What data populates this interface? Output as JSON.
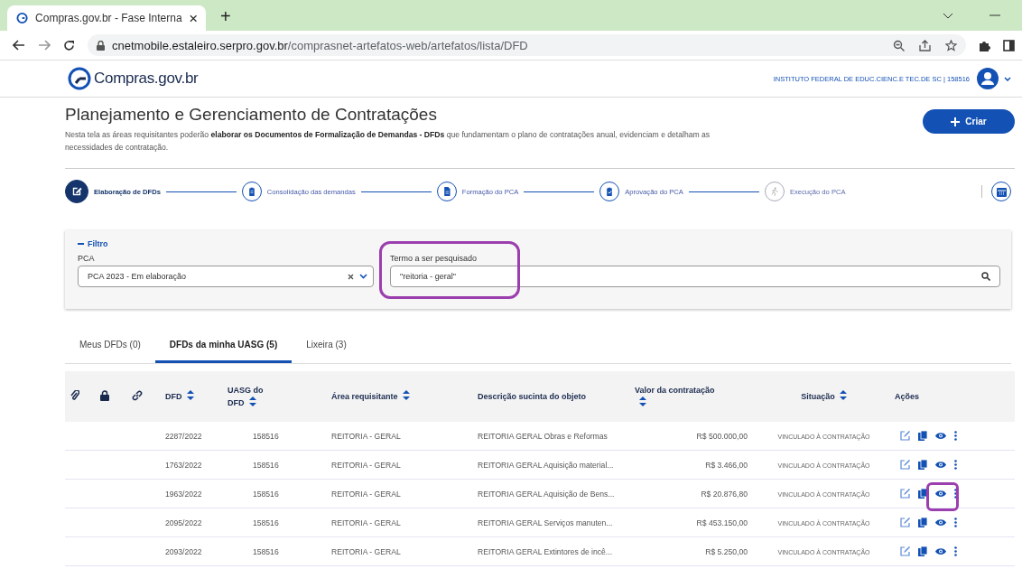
{
  "browser": {
    "tab_title": "Compras.gov.br - Fase Interna",
    "new_tab": "+",
    "url_host": "cnetmobile.estaleiro.serpro.gov.br",
    "url_path": "/comprasnet-artefatos-web/artefatos/lista/DFD"
  },
  "header": {
    "logo_text": "Compras.gov.br",
    "org": "INSTITUTO FEDERAL DE EDUC.CIENC.E TEC.DE SC | 158516"
  },
  "page": {
    "title": "Planejamento e Gerenciamento de Contratações",
    "description": "Nesta tela as áreas requisitantes poderão **elaborar os Documentos de Formalização de Demandas - DFDs** que fundamentam o plano de contratações anual, evidenciam e detalham as necessidades de contratação.",
    "create_button": "Criar"
  },
  "steps": [
    {
      "label": "Elaboração de DFDs",
      "selected": true,
      "disabled": false
    },
    {
      "label": "Consolidação das demandas",
      "selected": false,
      "disabled": false
    },
    {
      "label": "Formação do PCA",
      "selected": false,
      "disabled": false
    },
    {
      "label": "Aprovação do PCA",
      "selected": false,
      "disabled": false
    },
    {
      "label": "Execução do PCA",
      "selected": false,
      "disabled": true
    }
  ],
  "filter": {
    "title": "Filtro",
    "expanded": true,
    "pca_label": "PCA",
    "pca_value": "PCA 2023 - Em elaboração",
    "search_label": "Termo a ser pesquisado",
    "search_value": "\"reitoria - geral\"",
    "search_highlighted": true
  },
  "tabs": [
    {
      "label": "Meus DFDs (0)",
      "selected": false
    },
    {
      "label": "DFDs da minha UASG (5)",
      "selected": true
    },
    {
      "label": "Lixeira (3)",
      "selected": false
    }
  ],
  "table": {
    "columns": [
      {
        "label": "DFD",
        "sortable": true
      },
      {
        "label": "UASG do DFD",
        "sortable": true
      },
      {
        "label": "Área requisitante",
        "sortable": true
      },
      {
        "label": "Descrição sucinta do objeto",
        "sortable": false
      },
      {
        "label": "Valor da contratação",
        "sortable": true
      },
      {
        "label": "Situação",
        "sortable": true
      },
      {
        "label": "Ações",
        "sortable": false
      }
    ],
    "rows": [
      {
        "dfd": "2287/2022",
        "uasg": "158516",
        "area": "REITORIA - GERAL",
        "descricao": "REITORIA GERAL Obras e Reformas",
        "valor": "R$ 500.000,00",
        "situacao": "VINCULADO À CONTRATAÇÃO",
        "view_highlighted": false
      },
      {
        "dfd": "1763/2022",
        "uasg": "158516",
        "area": "REITORIA - GERAL",
        "descricao": "REITORIA GERAL Aquisição material...",
        "valor": "R$ 3.466,00",
        "situacao": "VINCULADO À CONTRATAÇÃO",
        "view_highlighted": false
      },
      {
        "dfd": "1963/2022",
        "uasg": "158516",
        "area": "REITORIA - GERAL",
        "descricao": "REITORIA GERAL Aquisição de Bens...",
        "valor": "R$ 20.876,80",
        "situacao": "VINCULADO À CONTRATAÇÃO",
        "view_highlighted": true
      },
      {
        "dfd": "2095/2022",
        "uasg": "158516",
        "area": "REITORIA - GERAL",
        "descricao": "REITORIA GERAL Serviços manuten...",
        "valor": "R$ 453.150,00",
        "situacao": "VINCULADO À CONTRATAÇÃO",
        "view_highlighted": false
      },
      {
        "dfd": "2093/2022",
        "uasg": "158516",
        "area": "REITORIA - GERAL",
        "descricao": "REITORIA GERAL Extintores de incê...",
        "valor": "R$ 5.250,00",
        "situacao": "VINCULADO À CONTRATAÇÃO",
        "view_highlighted": false
      }
    ]
  }
}
